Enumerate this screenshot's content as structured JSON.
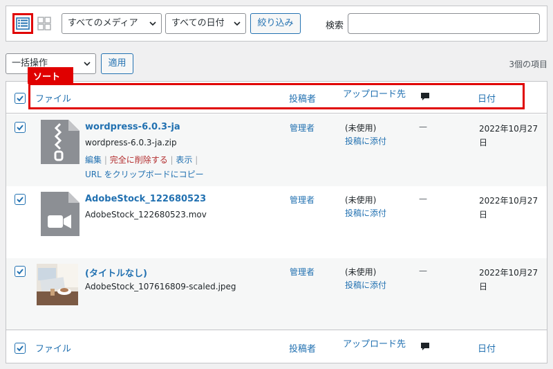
{
  "toolbar": {
    "media_filter": "すべてのメディア",
    "date_filter": "すべての日付",
    "filter_button": "絞り込み",
    "search_label": "検索",
    "search_value": ""
  },
  "bulk": {
    "action": "一括操作",
    "apply_button": "適用",
    "item_count": "3個の項目"
  },
  "annotation": {
    "sort_label": "ソート"
  },
  "columns": {
    "file": "ファイル",
    "author": "投稿者",
    "uploaded_to": "アップロード先",
    "date": "日付"
  },
  "rows": [
    {
      "title": "wordpress-6.0.3-ja",
      "filename": "wordpress-6.0.3-ja.zip",
      "author": "管理者",
      "uploaded": "(未使用)",
      "attach": "投稿に添付",
      "comments": "—",
      "date": "2022年10月27日",
      "actions": {
        "edit": "編集",
        "delete": "完全に削除する",
        "view": "表示",
        "copy": "URL をクリップボードにコピー"
      },
      "checked": true
    },
    {
      "title": "AdobeStock_122680523",
      "filename": "AdobeStock_122680523.mov",
      "author": "管理者",
      "uploaded": "(未使用)",
      "attach": "投稿に添付",
      "comments": "—",
      "date": "2022年10月27日",
      "checked": true
    },
    {
      "title": "(タイトルなし)",
      "filename": "AdobeStock_107616809-scaled.jpeg",
      "author": "管理者",
      "uploaded": "(未使用)",
      "attach": "投稿に添付",
      "comments": "—",
      "date": "2022年10月27日",
      "checked": true
    }
  ],
  "colors": {
    "accent": "#2271b1",
    "highlight": "#e00000",
    "delete": "#b32d2e"
  }
}
